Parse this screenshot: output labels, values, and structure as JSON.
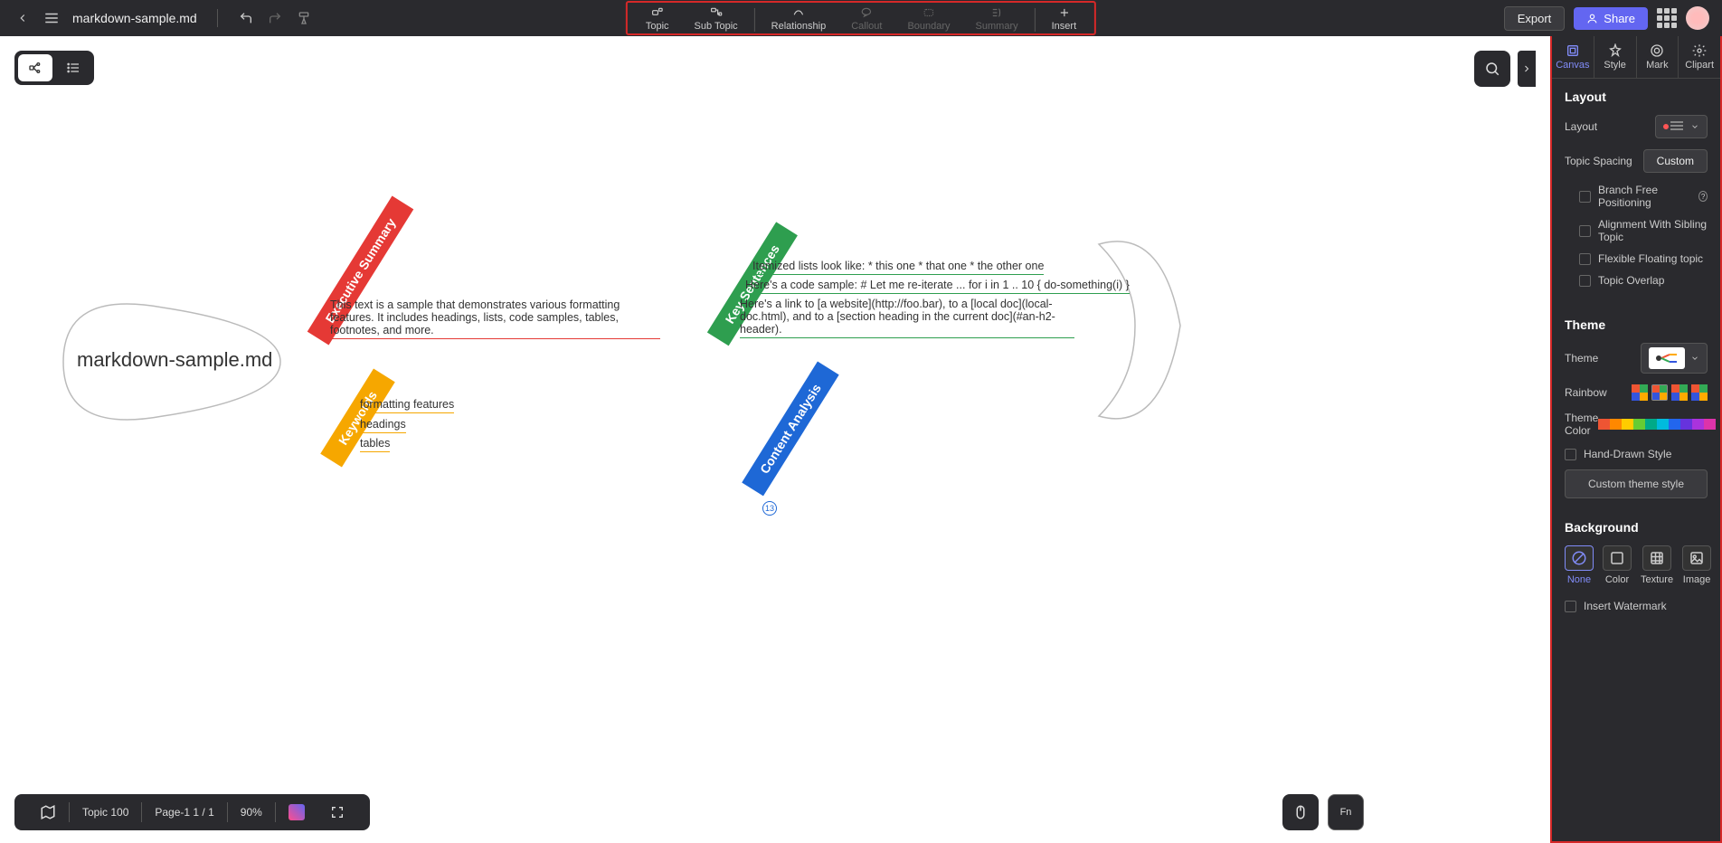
{
  "topbar": {
    "filename": "markdown-sample.md",
    "tools": [
      {
        "label": "Topic",
        "enabled": true
      },
      {
        "label": "Sub Topic",
        "enabled": true
      },
      {
        "label": "Relationship",
        "enabled": true
      },
      {
        "label": "Callout",
        "enabled": false
      },
      {
        "label": "Boundary",
        "enabled": false
      },
      {
        "label": "Summary",
        "enabled": false
      },
      {
        "label": "Insert",
        "enabled": true
      }
    ],
    "export": "Export",
    "share": "Share"
  },
  "mindmap": {
    "root": "markdown-sample.md",
    "branches": {
      "exec_summary": {
        "label": "Executive Summary",
        "text": "This text is a sample that demonstrates various formatting features. It includes headings, lists, code samples, tables, footnotes, and more."
      },
      "keywords": {
        "label": "Keywords",
        "items": [
          "formatting features",
          "headings",
          "tables"
        ]
      },
      "key_sentences": {
        "label": "Key Sentences",
        "items": [
          "Itemized lists look like: * this one * that one * the other one",
          "Here's a code sample: # Let me re-iterate ... for i in 1 .. 10 { do-something(i) }",
          "Here's a link to [a website](http://foo.bar), to a [local doc](local-doc.html), and to a [section heading in the current doc](#an-h2-header)."
        ]
      },
      "content_analysis": {
        "label": "Content Analysis",
        "badge": "13"
      }
    }
  },
  "bottombar": {
    "topic": "Topic 100",
    "page": "Page-1  1 / 1",
    "zoom": "90%"
  },
  "panel": {
    "tabs": [
      "Canvas",
      "Style",
      "Mark",
      "Clipart"
    ],
    "layout": {
      "title": "Layout",
      "layout_label": "Layout",
      "spacing_label": "Topic Spacing",
      "spacing_btn": "Custom",
      "branch_free": "Branch Free Positioning",
      "align_sibling": "Alignment With Sibling Topic",
      "flex_float": "Flexible Floating topic",
      "overlap": "Topic Overlap"
    },
    "theme": {
      "title": "Theme",
      "theme_label": "Theme",
      "rainbow_label": "Rainbow",
      "color_label": "Theme Color",
      "handdrawn": "Hand-Drawn Style",
      "custom_btn": "Custom theme style"
    },
    "background": {
      "title": "Background",
      "options": [
        "None",
        "Color",
        "Texture",
        "Image"
      ],
      "watermark": "Insert Watermark"
    }
  }
}
